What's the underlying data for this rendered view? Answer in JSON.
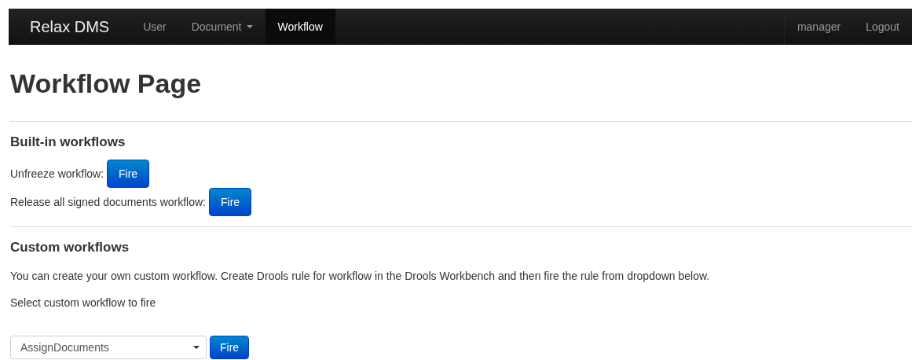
{
  "navbar": {
    "brand": "Relax DMS",
    "items": [
      {
        "label": "User",
        "selected": false,
        "dropdown": false
      },
      {
        "label": "Document",
        "selected": false,
        "dropdown": true
      },
      {
        "label": "Workflow",
        "selected": true,
        "dropdown": false
      }
    ],
    "right_items": [
      "manager",
      "Logout"
    ]
  },
  "title": "Workflow Page",
  "built_in": {
    "heading": "Built-in workflows",
    "rows": [
      {
        "label": "Unfreeze workflow:",
        "button": "Fire"
      },
      {
        "label": "Release all signed documents workflow:",
        "button": "Fire"
      }
    ]
  },
  "custom": {
    "heading": "Custom workflows",
    "description": "You can create your own custom workflow. Create Drools rule for workflow in the Drools Workbench and then fire the rule from dropdown below.",
    "select_label": "Select custom workflow to fire",
    "select": {
      "value": "AssignDocuments"
    },
    "button": "Fire"
  }
}
